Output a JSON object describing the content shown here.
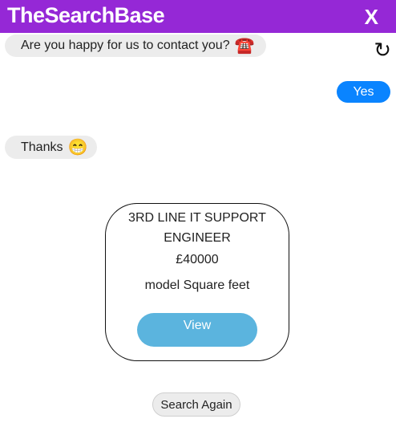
{
  "header": {
    "brand": "TheSearchBase",
    "close_label": "X"
  },
  "chat": {
    "question_text": "Are you happy for us to contact you?",
    "question_emoji": "☎️",
    "refresh_glyph": "↻",
    "user_reply": "Yes",
    "thanks_text": "Thanks",
    "thanks_emoji": "😁"
  },
  "job_card": {
    "title": "3RD LINE IT SUPPORT ENGINEER",
    "salary": "£40000",
    "location": "model Square feet",
    "view_label": "View"
  },
  "search_again_label": "Search Again",
  "colors": {
    "header_bg": "#9528d6",
    "user_bubble": "#0a84ff",
    "view_button": "#5bb4de",
    "bot_bubble": "#ececec"
  },
  "icons": {
    "refresh": "refresh-icon",
    "phone": "telephone-icon",
    "grin": "grin-emoji-icon"
  }
}
